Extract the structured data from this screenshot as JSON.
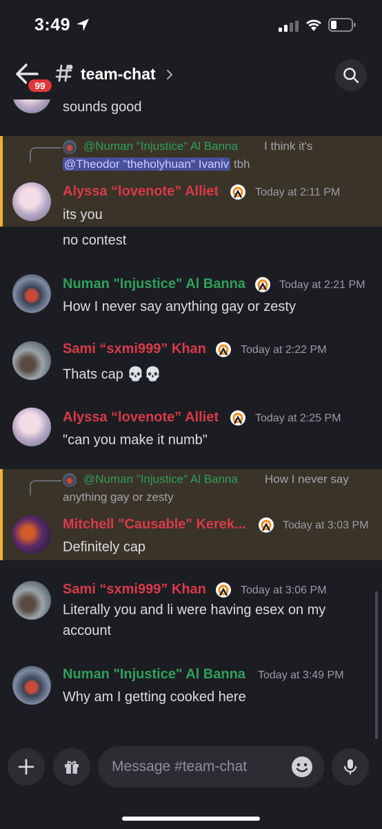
{
  "status_bar": {
    "time": "3:49"
  },
  "header": {
    "badge": "99",
    "channel": "team-chat"
  },
  "messages": {
    "m1_text": "sounds good",
    "reply1": {
      "name": "@Numan \"Injustice\" Al Banna",
      "text1": "I think it's",
      "mention": "@Theodor \"theholyhuan\" Ivaniv",
      "text2": "tbh"
    },
    "m2": {
      "name": "Alyssa “lovenote” Alliet",
      "time": "Today at 2:11 PM",
      "line1": "its you",
      "line2": "no contest"
    },
    "m3": {
      "name": "Numan \"Injustice\" Al Banna",
      "time": "Today at 2:21 PM",
      "text": "How I never say anything gay or zesty"
    },
    "m4": {
      "name": "Sami “sxmi999” Khan",
      "time": "Today at 2:22 PM",
      "text": "Thats cap 💀💀"
    },
    "m5": {
      "name": "Alyssa “lovenote” Alliet",
      "time": "Today at 2:25 PM",
      "text": "\"can you make it numb\""
    },
    "reply2": {
      "name": "@Numan \"Injustice\" Al Banna",
      "text1": "How I never say",
      "text2": "anything gay or zesty"
    },
    "m6": {
      "name": "Mitchell \"Causable\" Kerek...",
      "time": "Today at 3:03 PM",
      "text": "Definitely cap"
    },
    "m7": {
      "name": "Sami “sxmi999” Khan",
      "time": "Today at 3:06 PM",
      "line1": "Literally you and li were having esex on my",
      "line2": "account"
    },
    "m8": {
      "name": "Numan \"Injustice\" Al Banna",
      "time": "Today at 3:49 PM",
      "text": "Why am I getting cooked here"
    }
  },
  "composer": {
    "placeholder": "Message #team-chat"
  },
  "colors": {
    "highlight": "#3a3328",
    "highlight_bar": "#f0b232",
    "red_name": "#d93a4a",
    "green_name": "#2fa05a",
    "mention_bg": "#4a4f9c"
  }
}
